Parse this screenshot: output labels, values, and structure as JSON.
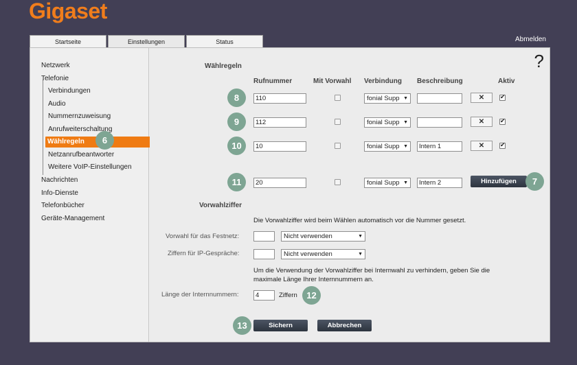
{
  "brand": {
    "logo_text": "Gigaset"
  },
  "tabs": [
    {
      "label": "Startseite"
    },
    {
      "label": "Einstellungen"
    },
    {
      "label": "Status"
    }
  ],
  "logout_label": "Abmelden",
  "sidebar": {
    "items": [
      {
        "label": "Netzwerk"
      },
      {
        "label": "Telefonie"
      },
      {
        "label": "Verbindungen"
      },
      {
        "label": "Audio"
      },
      {
        "label": "Nummernzuweisung"
      },
      {
        "label": "Anrufweiterschaltung"
      },
      {
        "label": "Wählregeln"
      },
      {
        "label": "Netzanrufbeantworter"
      },
      {
        "label": "Weitere VoIP-Einstellungen"
      },
      {
        "label": "Nachrichten"
      },
      {
        "label": "Info-Dienste"
      },
      {
        "label": "Telefonbücher"
      },
      {
        "label": "Geräte-Management"
      }
    ]
  },
  "main": {
    "help_symbol": "?",
    "section_dialrules": "Wählregeln",
    "columns": {
      "number": "Rufnummer",
      "prefix": "Mit Vorwahl",
      "connection": "Verbindung",
      "description": "Beschreibung",
      "active": "Aktiv"
    },
    "rows": [
      {
        "number": "110",
        "connection": "fonial Supp",
        "description": "",
        "delete": "✕",
        "prefix_checked": false,
        "active_checked": true
      },
      {
        "number": "112",
        "connection": "fonial Supp",
        "description": "",
        "delete": "✕",
        "prefix_checked": false,
        "active_checked": true
      },
      {
        "number": "10",
        "connection": "fonial Supp",
        "description": "Intern 1",
        "delete": "✕",
        "prefix_checked": false,
        "active_checked": true
      }
    ],
    "new_row": {
      "number": "20",
      "connection": "fonial Supp",
      "description": "Intern 2",
      "add_label": "Hinzufügen",
      "prefix_checked": false
    },
    "section_prefix": "Vorwahlziffer",
    "prefix_info": "Die Vorwahlziffer wird beim Wählen automatisch vor die Nummer gesetzt.",
    "landline_label": "Vorwahl für das Festnetz:",
    "landline_value": "",
    "landline_option": "Nicht verwenden",
    "ip_label": "Ziffern für IP-Gespräche:",
    "ip_value": "",
    "ip_option": "Nicht verwenden",
    "internal_info_1": "Um die Verwendung der Vorwahlziffer bei Internwahl zu verhindern, geben Sie die",
    "internal_info_2": "maximale Länge Ihrer Internnummern an.",
    "internal_length_label": "Länge der Internnummern:",
    "internal_length_value": "4",
    "internal_length_unit": "Ziffern",
    "save_label": "Sichern",
    "cancel_label": "Abbrechen"
  },
  "callouts": [
    "6",
    "7",
    "8",
    "9",
    "10",
    "11",
    "12",
    "13"
  ],
  "colors": {
    "accent": "#ef7b13",
    "background": "#423f55",
    "callout": "#7ea593"
  }
}
